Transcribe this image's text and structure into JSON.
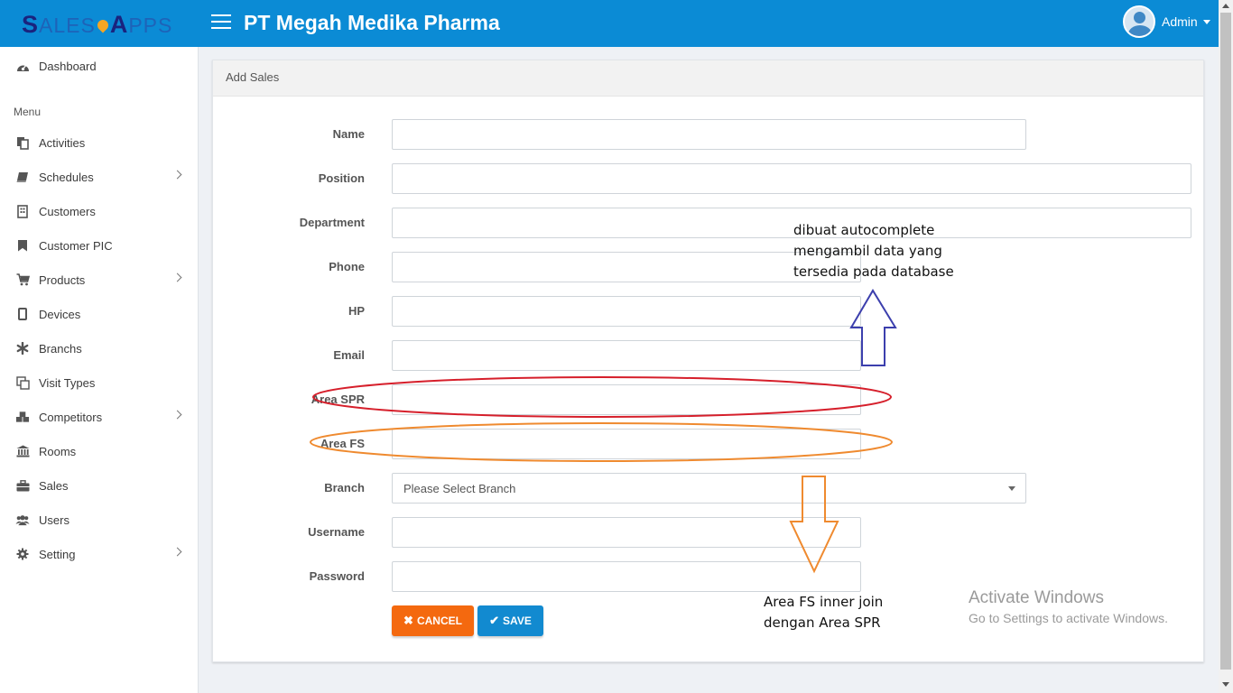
{
  "app": {
    "logo_part1": "S",
    "logo_part2": "ALES",
    "logo_part3": "A",
    "logo_part4": "PPS",
    "company": "PT Megah Medika Pharma",
    "user_name": "Admin"
  },
  "sidebar": {
    "dashboard": "Dashboard",
    "menu_header": "Menu",
    "items": [
      {
        "label": "Activities",
        "icon": "copy-icon"
      },
      {
        "label": "Schedules",
        "icon": "book-icon"
      },
      {
        "label": "Customers",
        "icon": "building-icon"
      },
      {
        "label": "Customer PIC",
        "icon": "bookmark-icon"
      },
      {
        "label": "Products",
        "icon": "cart-icon"
      },
      {
        "label": "Devices",
        "icon": "mobile-icon"
      },
      {
        "label": "Branchs",
        "icon": "asterisk-icon"
      },
      {
        "label": "Visit Types",
        "icon": "clone-icon"
      },
      {
        "label": "Competitors",
        "icon": "cubes-icon"
      },
      {
        "label": "Rooms",
        "icon": "bank-icon"
      },
      {
        "label": "Sales",
        "icon": "briefcase-icon"
      },
      {
        "label": "Users",
        "icon": "users-icon"
      },
      {
        "label": "Setting",
        "icon": "gear-icon"
      }
    ]
  },
  "panel": {
    "title": "Add Sales"
  },
  "form": {
    "name_label": "Name",
    "position_label": "Position",
    "department_label": "Department",
    "phone_label": "Phone",
    "hp_label": "HP",
    "email_label": "Email",
    "area_spr_label": "Area SPR",
    "area_fs_label": "Area FS",
    "branch_label": "Branch",
    "branch_placeholder": "Please Select Branch",
    "username_label": "Username",
    "password_label": "Password",
    "cancel_label": "CANCEL",
    "save_label": "SAVE"
  },
  "annotations": {
    "note1_line1": "dibuat autocomplete",
    "note1_line2": "mengambil data yang",
    "note1_line3": "tersedia pada database",
    "note2_line1": "Area FS inner join",
    "note2_line2": "dengan Area SPR",
    "colors": {
      "red": "#d61f2b",
      "orange": "#ef8a2f",
      "blue": "#3c3fad"
    }
  },
  "watermark": {
    "title": "Activate Windows",
    "subtitle": "Go to Settings to activate Windows."
  },
  "theme": {
    "primary": "#0b8bd5",
    "cancel": "#f4690f",
    "save": "#128ad0"
  }
}
